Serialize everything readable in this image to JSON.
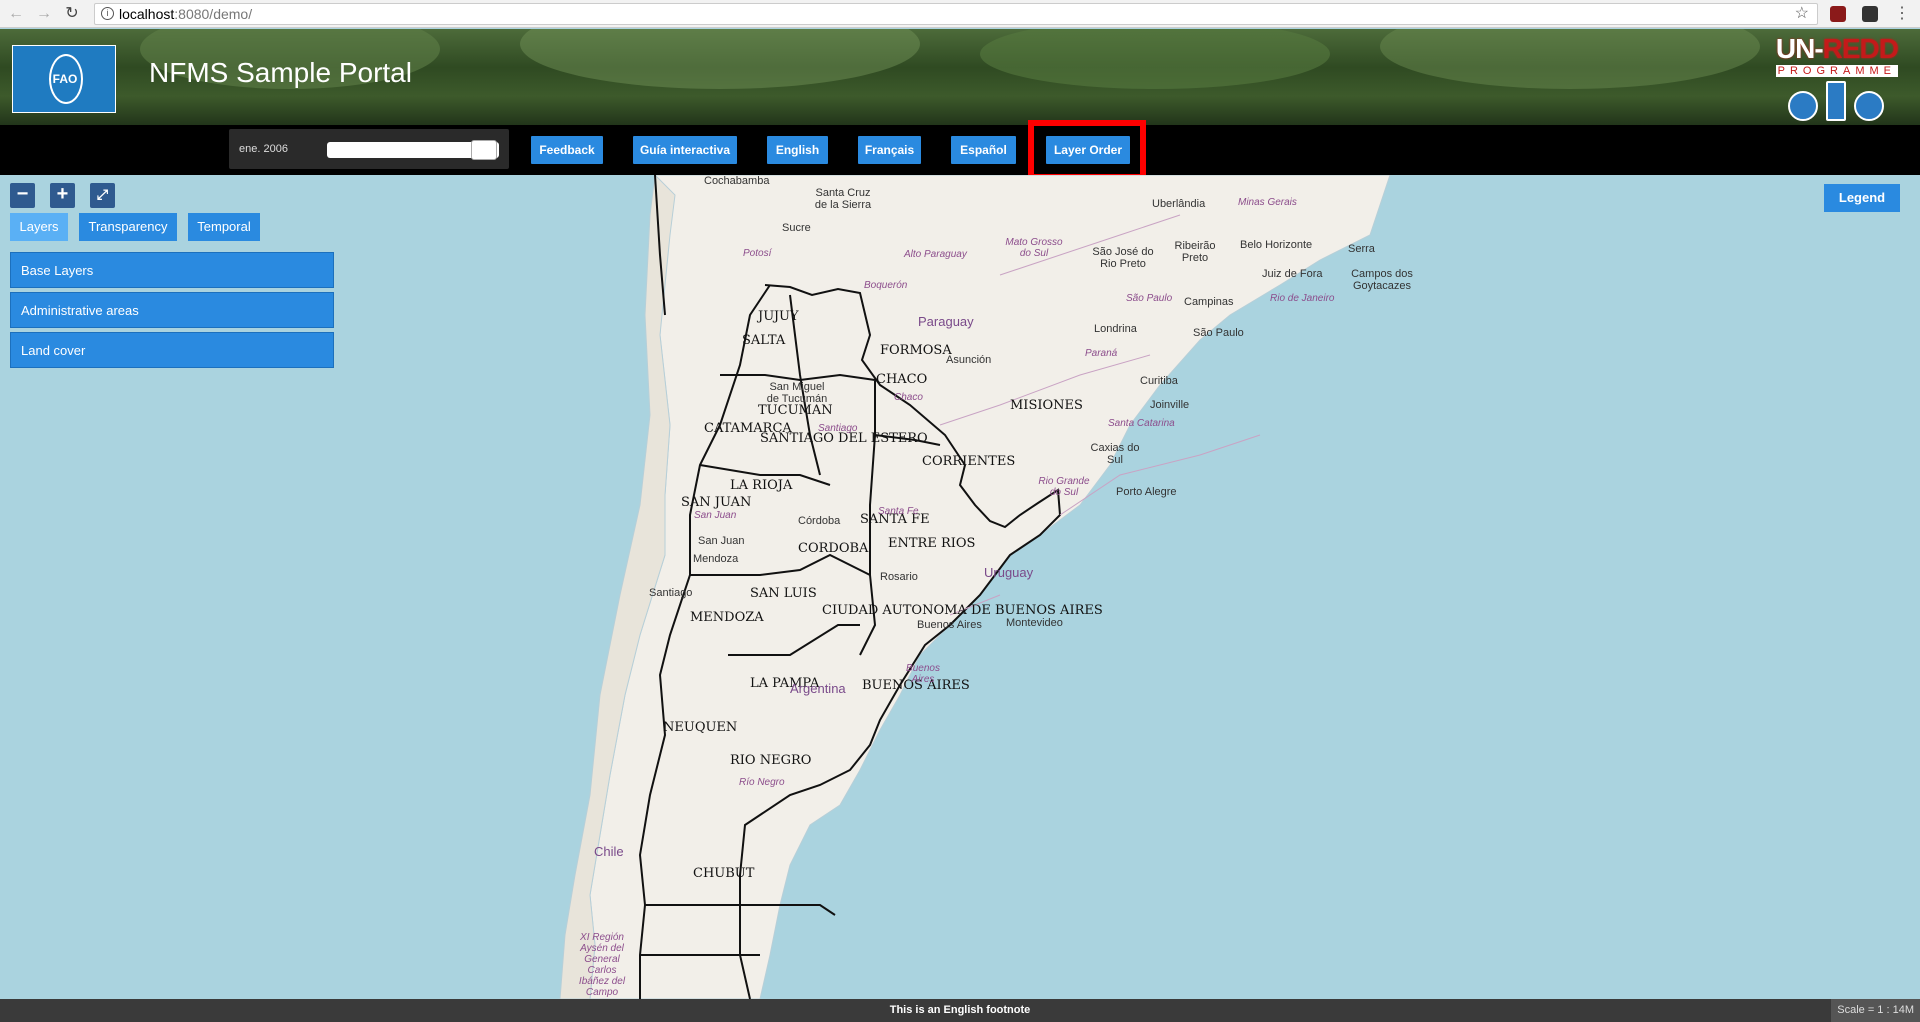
{
  "browser": {
    "url_host": "localhost",
    "url_path": ":8080/demo/"
  },
  "header": {
    "logo_text": "FAO",
    "title": "NFMS Sample Portal",
    "brand_un": "UN-",
    "brand_redd": "REDD",
    "brand_programme": "PROGRAMME"
  },
  "toolbar": {
    "time_label": "ene. 2006",
    "buttons": [
      "Feedback",
      "Guía interactiva",
      "English",
      "Français",
      "Español",
      "Layer Order"
    ]
  },
  "panel": {
    "tabs": [
      "Layers",
      "Transparency",
      "Temporal"
    ],
    "active_tab": "Layers",
    "groups": [
      "Base Layers",
      "Administrative areas",
      "Land cover"
    ]
  },
  "map": {
    "legend_label": "Legend",
    "provinces": [
      "JUJUY",
      "SALTA",
      "FORMOSA",
      "CHACO",
      "MISIONES",
      "TUCUMAN",
      "CATAMARCA",
      "SANTIAGO DEL ESTERO",
      "CORRIENTES",
      "LA RIOJA",
      "SAN JUAN",
      "SANTA FE",
      "ENTRE RIOS",
      "CORDOBA",
      "SAN LUIS",
      "MENDOZA",
      "CIUDAD AUTONOMA DE BUENOS AIRES",
      "LA PAMPA",
      "BUENOS AIRES",
      "NEUQUEN",
      "RIO NEGRO",
      "CHUBUT"
    ],
    "cities": [
      "Cochabamba",
      "Santa Cruz de la Sierra",
      "Sucre",
      "Uberlândia",
      "Ribeirão Preto",
      "Belo Horizonte",
      "Serra",
      "São José do Rio Preto",
      "Juiz de Fora",
      "Campos dos Goytacazes",
      "Campinas",
      "São Paulo",
      "Londrina",
      "Asunción",
      "Curitiba",
      "Joinville",
      "San Miguel de Tucumán",
      "Caxias do Sul",
      "Porto Alegre",
      "Córdoba",
      "Rosario",
      "Mendoza",
      "San Juan",
      "Santiago",
      "Buenos Aires",
      "Montevideo"
    ],
    "regions": [
      "Minas Gerais",
      "Mato Grosso do Sul",
      "Alto Paraguay",
      "Potosí",
      "Boquerón",
      "São Paulo",
      "Rio de Janeiro",
      "Paraná",
      "Chaco",
      "Santiago",
      "Santa Catarina",
      "Rio Grande do Sul",
      "Santa Fe",
      "San Juan",
      "Buenos Aires",
      "Río Negro",
      "XI Región Aysén del General Carlos Ibáñez del Campo"
    ],
    "countries": [
      "Paraguay",
      "Uruguay",
      "Chile",
      "Argentina"
    ]
  },
  "footer": {
    "text": "This is an English footnote",
    "scale": "Scale = 1 : 14M"
  }
}
